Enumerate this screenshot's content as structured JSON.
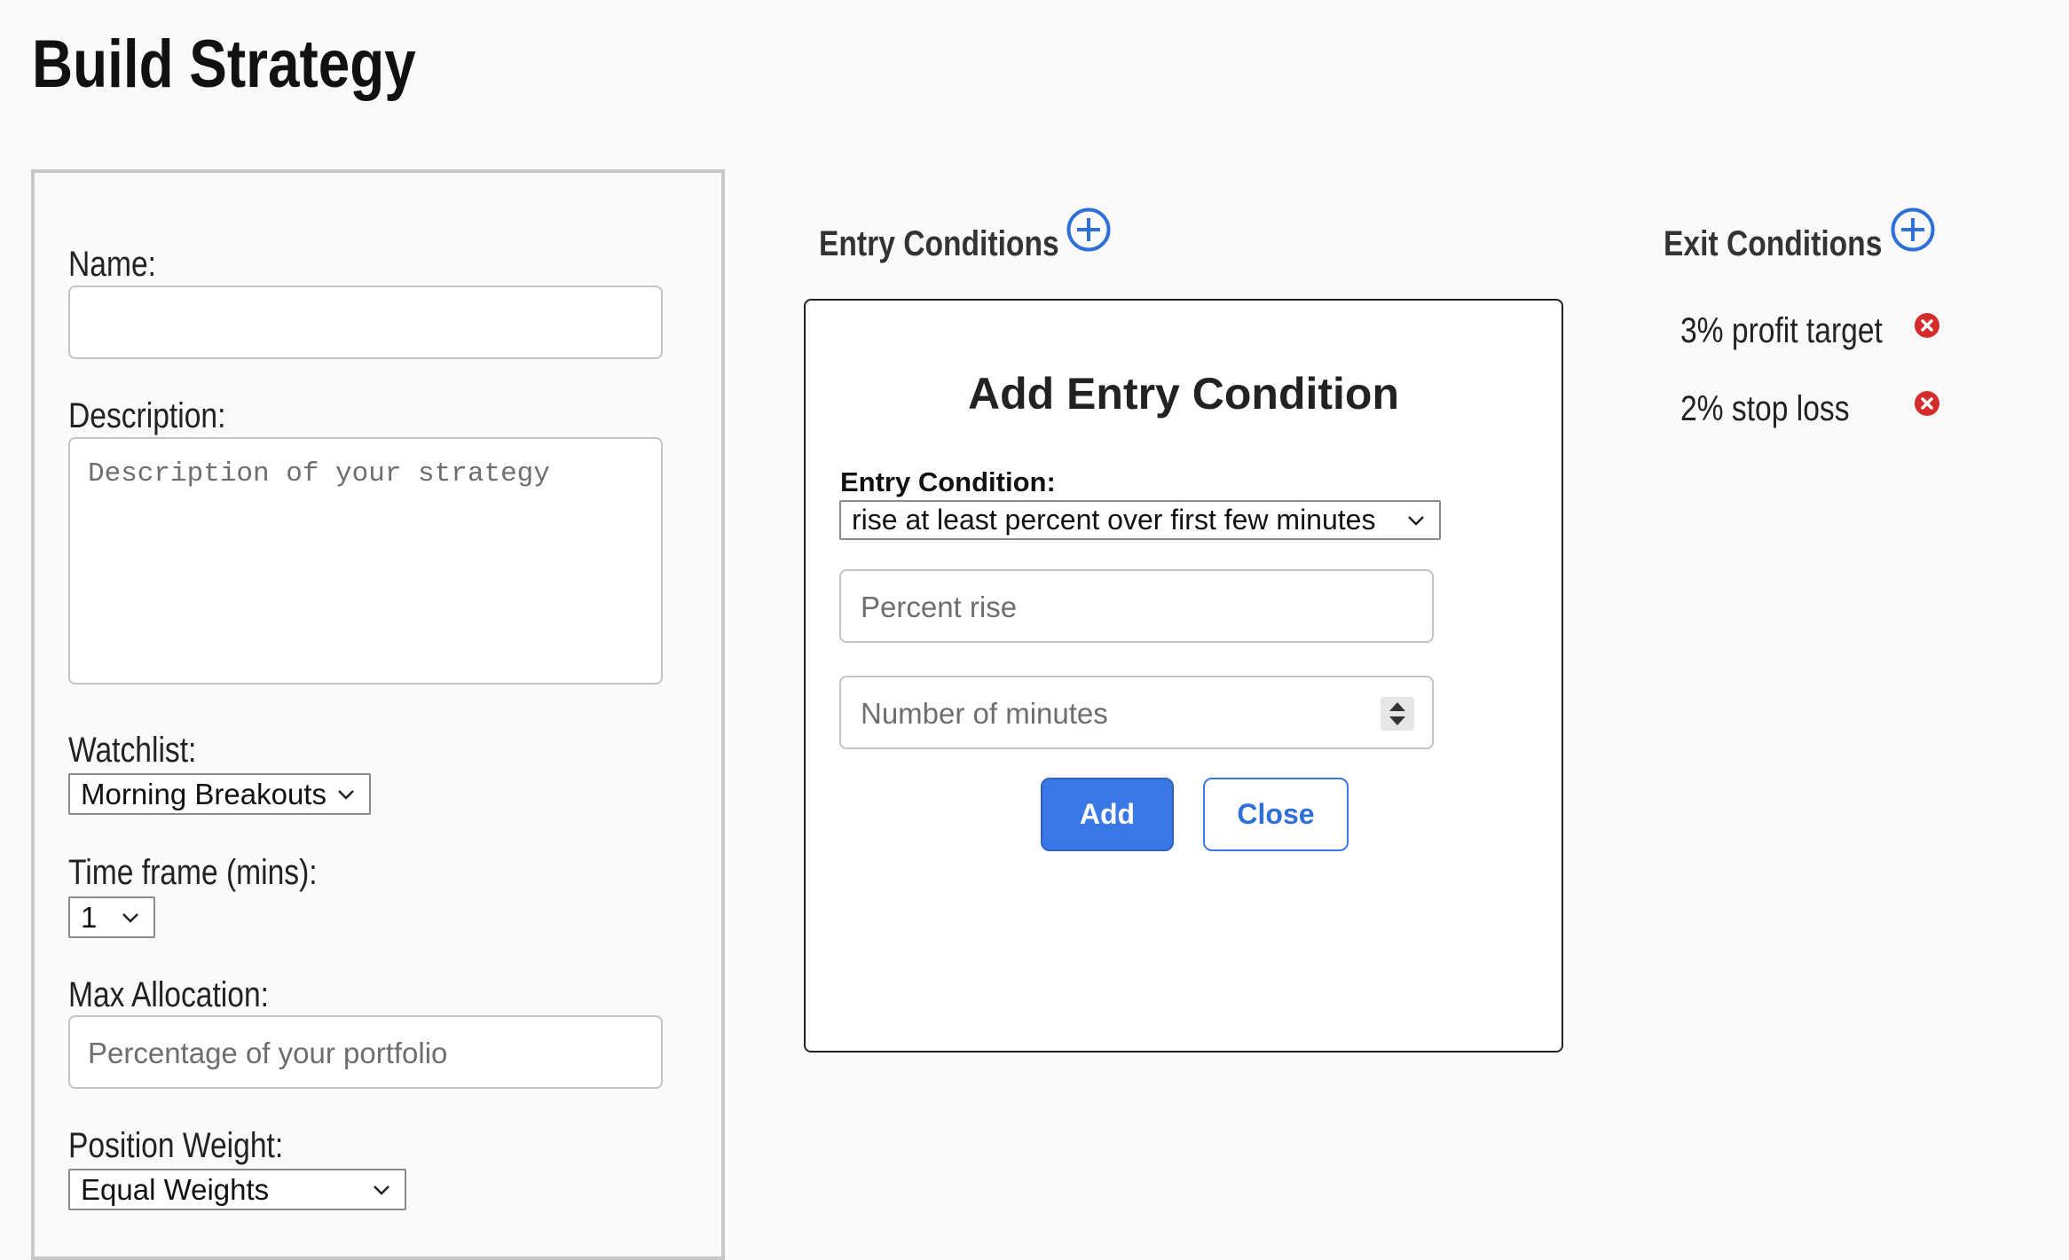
{
  "page": {
    "title": "Build Strategy"
  },
  "form": {
    "name_label": "Name:",
    "name_value": "",
    "description_label": "Description:",
    "description_placeholder": "Description of your strategy",
    "watchlist_label": "Watchlist:",
    "watchlist_value": "Morning Breakouts",
    "timeframe_label": "Time frame (mins):",
    "timeframe_value": "1",
    "max_allocation_label": "Max Allocation:",
    "max_allocation_placeholder": "Percentage of your portfolio",
    "position_weight_label": "Position Weight:",
    "position_weight_value": "Equal Weights"
  },
  "entry": {
    "heading": "Entry Conditions",
    "add_icon": "plus-circle-icon"
  },
  "modal": {
    "title": "Add Entry Condition",
    "condition_label": "Entry Condition:",
    "condition_value": "rise at least percent over first few minutes",
    "percent_placeholder": "Percent rise",
    "minutes_placeholder": "Number of minutes",
    "add_label": "Add",
    "close_label": "Close"
  },
  "exit": {
    "heading": "Exit Conditions",
    "add_icon": "plus-circle-icon",
    "remove_icon": "x-circle-icon",
    "items": [
      {
        "label": "3% profit target"
      },
      {
        "label": "2% stop loss"
      }
    ]
  },
  "colors": {
    "accent": "#3b78e7",
    "remove": "#d42b2b",
    "panel_border": "#c8c8c8"
  }
}
